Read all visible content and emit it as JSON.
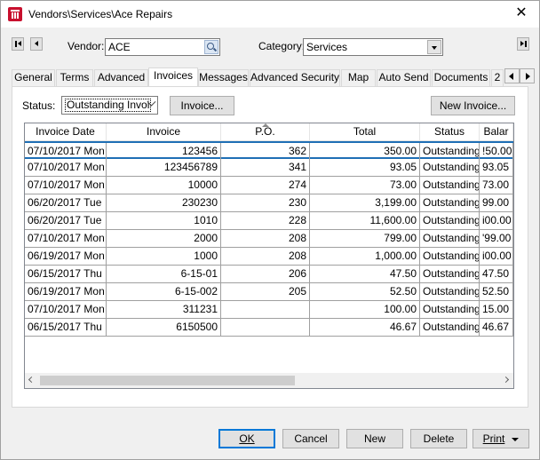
{
  "window": {
    "title": "Vendors\\Services\\Ace Repairs"
  },
  "filter": {
    "vendor_label": "Vendor:",
    "vendor_value": "ACE",
    "category_label": "Category:",
    "category_value": "Services"
  },
  "tabs": [
    "General",
    "Terms",
    "Advanced",
    "Invoices",
    "Messages",
    "Advanced Security",
    "Map",
    "Auto Send",
    "Documents",
    "2"
  ],
  "active_tab": "Invoices",
  "invoices": {
    "status_label": "Status:",
    "status_value": "Outstanding Invoi",
    "invoice_button": "Invoice...",
    "new_invoice_button": "New Invoice...",
    "columns": [
      "Invoice Date",
      "Invoice",
      "P.O.",
      "Total",
      "Status",
      "Balar"
    ],
    "rows": [
      [
        "07/10/2017 Mon",
        "123456",
        "362",
        "350.00",
        "Outstanding I",
        "!50.00"
      ],
      [
        "07/10/2017 Mon",
        "123456789",
        "341",
        "93.05",
        "Outstanding I",
        "93.05"
      ],
      [
        "07/10/2017 Mon",
        "10000",
        "274",
        "73.00",
        "Outstanding I",
        "73.00"
      ],
      [
        "06/20/2017 Tue",
        "230230",
        "230",
        "3,199.00",
        "Outstanding I",
        "99.00"
      ],
      [
        "06/20/2017 Tue",
        "1010",
        "228",
        "11,600.00",
        "Outstanding I",
        "i00.00"
      ],
      [
        "07/10/2017 Mon",
        "2000",
        "208",
        "799.00",
        "Outstanding I",
        "'99.00"
      ],
      [
        "06/19/2017 Mon",
        "1000",
        "208",
        "1,000.00",
        "Outstanding I",
        "i00.00"
      ],
      [
        "06/15/2017 Thu",
        "6-15-01",
        "206",
        "47.50",
        "Outstanding I",
        "47.50"
      ],
      [
        "06/19/2017 Mon",
        "6-15-002",
        "205",
        "52.50",
        "Outstanding I",
        "52.50"
      ],
      [
        "07/10/2017 Mon",
        "311231",
        "",
        "100.00",
        "Outstanding I",
        "15.00"
      ],
      [
        "06/15/2017 Thu",
        "6150500",
        "",
        "46.67",
        "Outstanding I",
        "46.67"
      ]
    ]
  },
  "footer": {
    "ok": "OK",
    "cancel": "Cancel",
    "new": "New",
    "delete": "Delete",
    "print": "Print"
  }
}
